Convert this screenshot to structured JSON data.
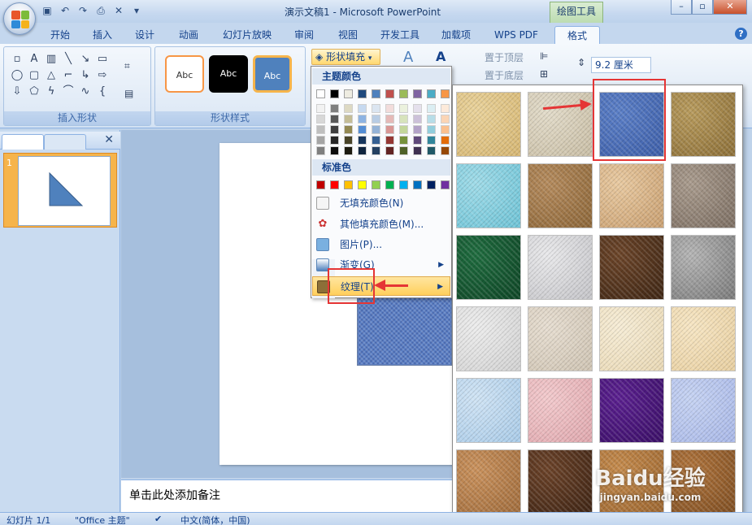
{
  "window": {
    "title": "演示文稿1 - Microsoft PowerPoint",
    "context_tools": "绘图工具",
    "qat_icons": [
      "save-icon",
      "undo-icon",
      "redo-icon",
      "preview-icon",
      "close-icon"
    ]
  },
  "tabs": [
    {
      "label": "开始"
    },
    {
      "label": "插入"
    },
    {
      "label": "设计"
    },
    {
      "label": "动画"
    },
    {
      "label": "幻灯片放映"
    },
    {
      "label": "审阅"
    },
    {
      "label": "视图"
    },
    {
      "label": "开发工具"
    },
    {
      "label": "加载项"
    },
    {
      "label": "WPS PDF"
    },
    {
      "label": "格式",
      "active": true
    }
  ],
  "ribbon": {
    "insert_shapes_label": "插入形状",
    "shape_styles_label": "形状样式",
    "style_previews": [
      "Abc",
      "Abc",
      "Abc"
    ],
    "fill_button": "形状填充",
    "bring_front": "置于顶层",
    "send_back": "置于底层",
    "height_value": "9.2 厘米"
  },
  "fill_menu": {
    "theme_colors_label": "主题颜色",
    "standard_colors_label": "标准色",
    "theme_top_row": [
      "#ffffff",
      "#000000",
      "#eeece1",
      "#1f497d",
      "#4f81bd",
      "#c0504d",
      "#9bbb59",
      "#8064a2",
      "#4bacc6",
      "#f79646"
    ],
    "theme_shades": [
      [
        "#f2f2f2",
        "#7f7f7f",
        "#ddd9c3",
        "#c6d9f0",
        "#dbe5f1",
        "#f2dcdb",
        "#ebf1dd",
        "#e5e0ec",
        "#dbeef3",
        "#fdeada"
      ],
      [
        "#d8d8d8",
        "#595959",
        "#c4bd97",
        "#8db3e2",
        "#b8cce4",
        "#e5b9b7",
        "#d7e3bc",
        "#ccc1d9",
        "#b7dde8",
        "#fbd5b5"
      ],
      [
        "#bfbfbf",
        "#3f3f3f",
        "#938953",
        "#548dd4",
        "#95b3d7",
        "#d99694",
        "#c3d69b",
        "#b2a2c7",
        "#92cddc",
        "#fac08f"
      ],
      [
        "#a5a5a5",
        "#262626",
        "#494429",
        "#17365d",
        "#366092",
        "#953734",
        "#76923c",
        "#5f497a",
        "#31859b",
        "#e36c09"
      ],
      [
        "#7f7f7f",
        "#0c0c0c",
        "#1d1b10",
        "#0f243e",
        "#244061",
        "#632423",
        "#4f6128",
        "#3f3151",
        "#205867",
        "#974806"
      ]
    ],
    "standard_colors": [
      "#c00000",
      "#ff0000",
      "#ffc000",
      "#ffff00",
      "#92d050",
      "#00b050",
      "#00b0f0",
      "#0070c0",
      "#002060",
      "#7030a0"
    ],
    "items": [
      {
        "label": "无填充颜色(N)",
        "icon": "no-fill-icon"
      },
      {
        "label": "其他填充颜色(M)...",
        "icon": "palette-icon"
      },
      {
        "label": "图片(P)...",
        "icon": "picture-icon"
      },
      {
        "label": "渐变(G)",
        "icon": "gradient-icon",
        "submenu": true
      },
      {
        "label": "纹理(T)",
        "icon": "texture-icon",
        "submenu": true,
        "highlighted": true
      }
    ]
  },
  "textures": [
    {
      "name": "papyrus",
      "c1": "#e9d29a",
      "c2": "#d6b672"
    },
    {
      "name": "canvas",
      "c1": "#e2dbc9",
      "c2": "#c9bea5"
    },
    {
      "name": "denim",
      "c1": "#5a7ec6",
      "c2": "#3d5ea8"
    },
    {
      "name": "woven-mat",
      "c1": "#b79a5c",
      "c2": "#8c6f38"
    },
    {
      "name": "water-droplets",
      "c1": "#9fdbe8",
      "c2": "#6ec3d6"
    },
    {
      "name": "paper-bag",
      "c1": "#b48a5c",
      "c2": "#8c6638"
    },
    {
      "name": "fish-fossil",
      "c1": "#e8c9a0",
      "c2": "#c99f70"
    },
    {
      "name": "sand",
      "c1": "#a89a8c",
      "c2": "#7c6e62"
    },
    {
      "name": "green-marble",
      "c1": "#1e6b3e",
      "c2": "#0f4526"
    },
    {
      "name": "white-marble",
      "c1": "#e8e8ea",
      "c2": "#c4c4c8"
    },
    {
      "name": "brown-marble",
      "c1": "#6b4428",
      "c2": "#3e2614"
    },
    {
      "name": "granite",
      "c1": "#b4b4b4",
      "c2": "#7a7a7a"
    },
    {
      "name": "newsprint",
      "c1": "#ececec",
      "c2": "#d2d2d2"
    },
    {
      "name": "recycled-paper",
      "c1": "#e6ddd0",
      "c2": "#cfc4b3"
    },
    {
      "name": "parchment",
      "c1": "#f6ecd5",
      "c2": "#e9d8b4"
    },
    {
      "name": "stationery",
      "c1": "#f6e5c3",
      "c2": "#e8cfa0"
    },
    {
      "name": "blue-tissue-paper",
      "c1": "#cfe3f4",
      "c2": "#a9cbe8"
    },
    {
      "name": "pink-tissue-paper",
      "c1": "#f2c9cc",
      "c2": "#e0a8ae"
    },
    {
      "name": "purple-mesh",
      "c1": "#5a1f8f",
      "c2": "#3a0f66"
    },
    {
      "name": "bouquet",
      "c1": "#c5d2f2",
      "c2": "#a9b8e8"
    },
    {
      "name": "cork",
      "c1": "#c9915c",
      "c2": "#a06c3c"
    },
    {
      "name": "walnut",
      "c1": "#6b4228",
      "c2": "#3e2414"
    },
    {
      "name": "oak",
      "c1": "#c48a4c",
      "c2": "#9c6630"
    },
    {
      "name": "medium-wood",
      "c1": "#b0743c",
      "c2": "#7e4e22"
    }
  ],
  "left_pane": {
    "slide_number": "1"
  },
  "notes_placeholder": "单击此处添加备注",
  "status": {
    "slide_info": "幻灯片 1/1",
    "theme": "\"Office 主题\"",
    "language": "中文(简体，中国)"
  },
  "watermark": {
    "logo": "Baidu经验",
    "url": "jingyan.baidu.com"
  },
  "accent": "#15428b"
}
